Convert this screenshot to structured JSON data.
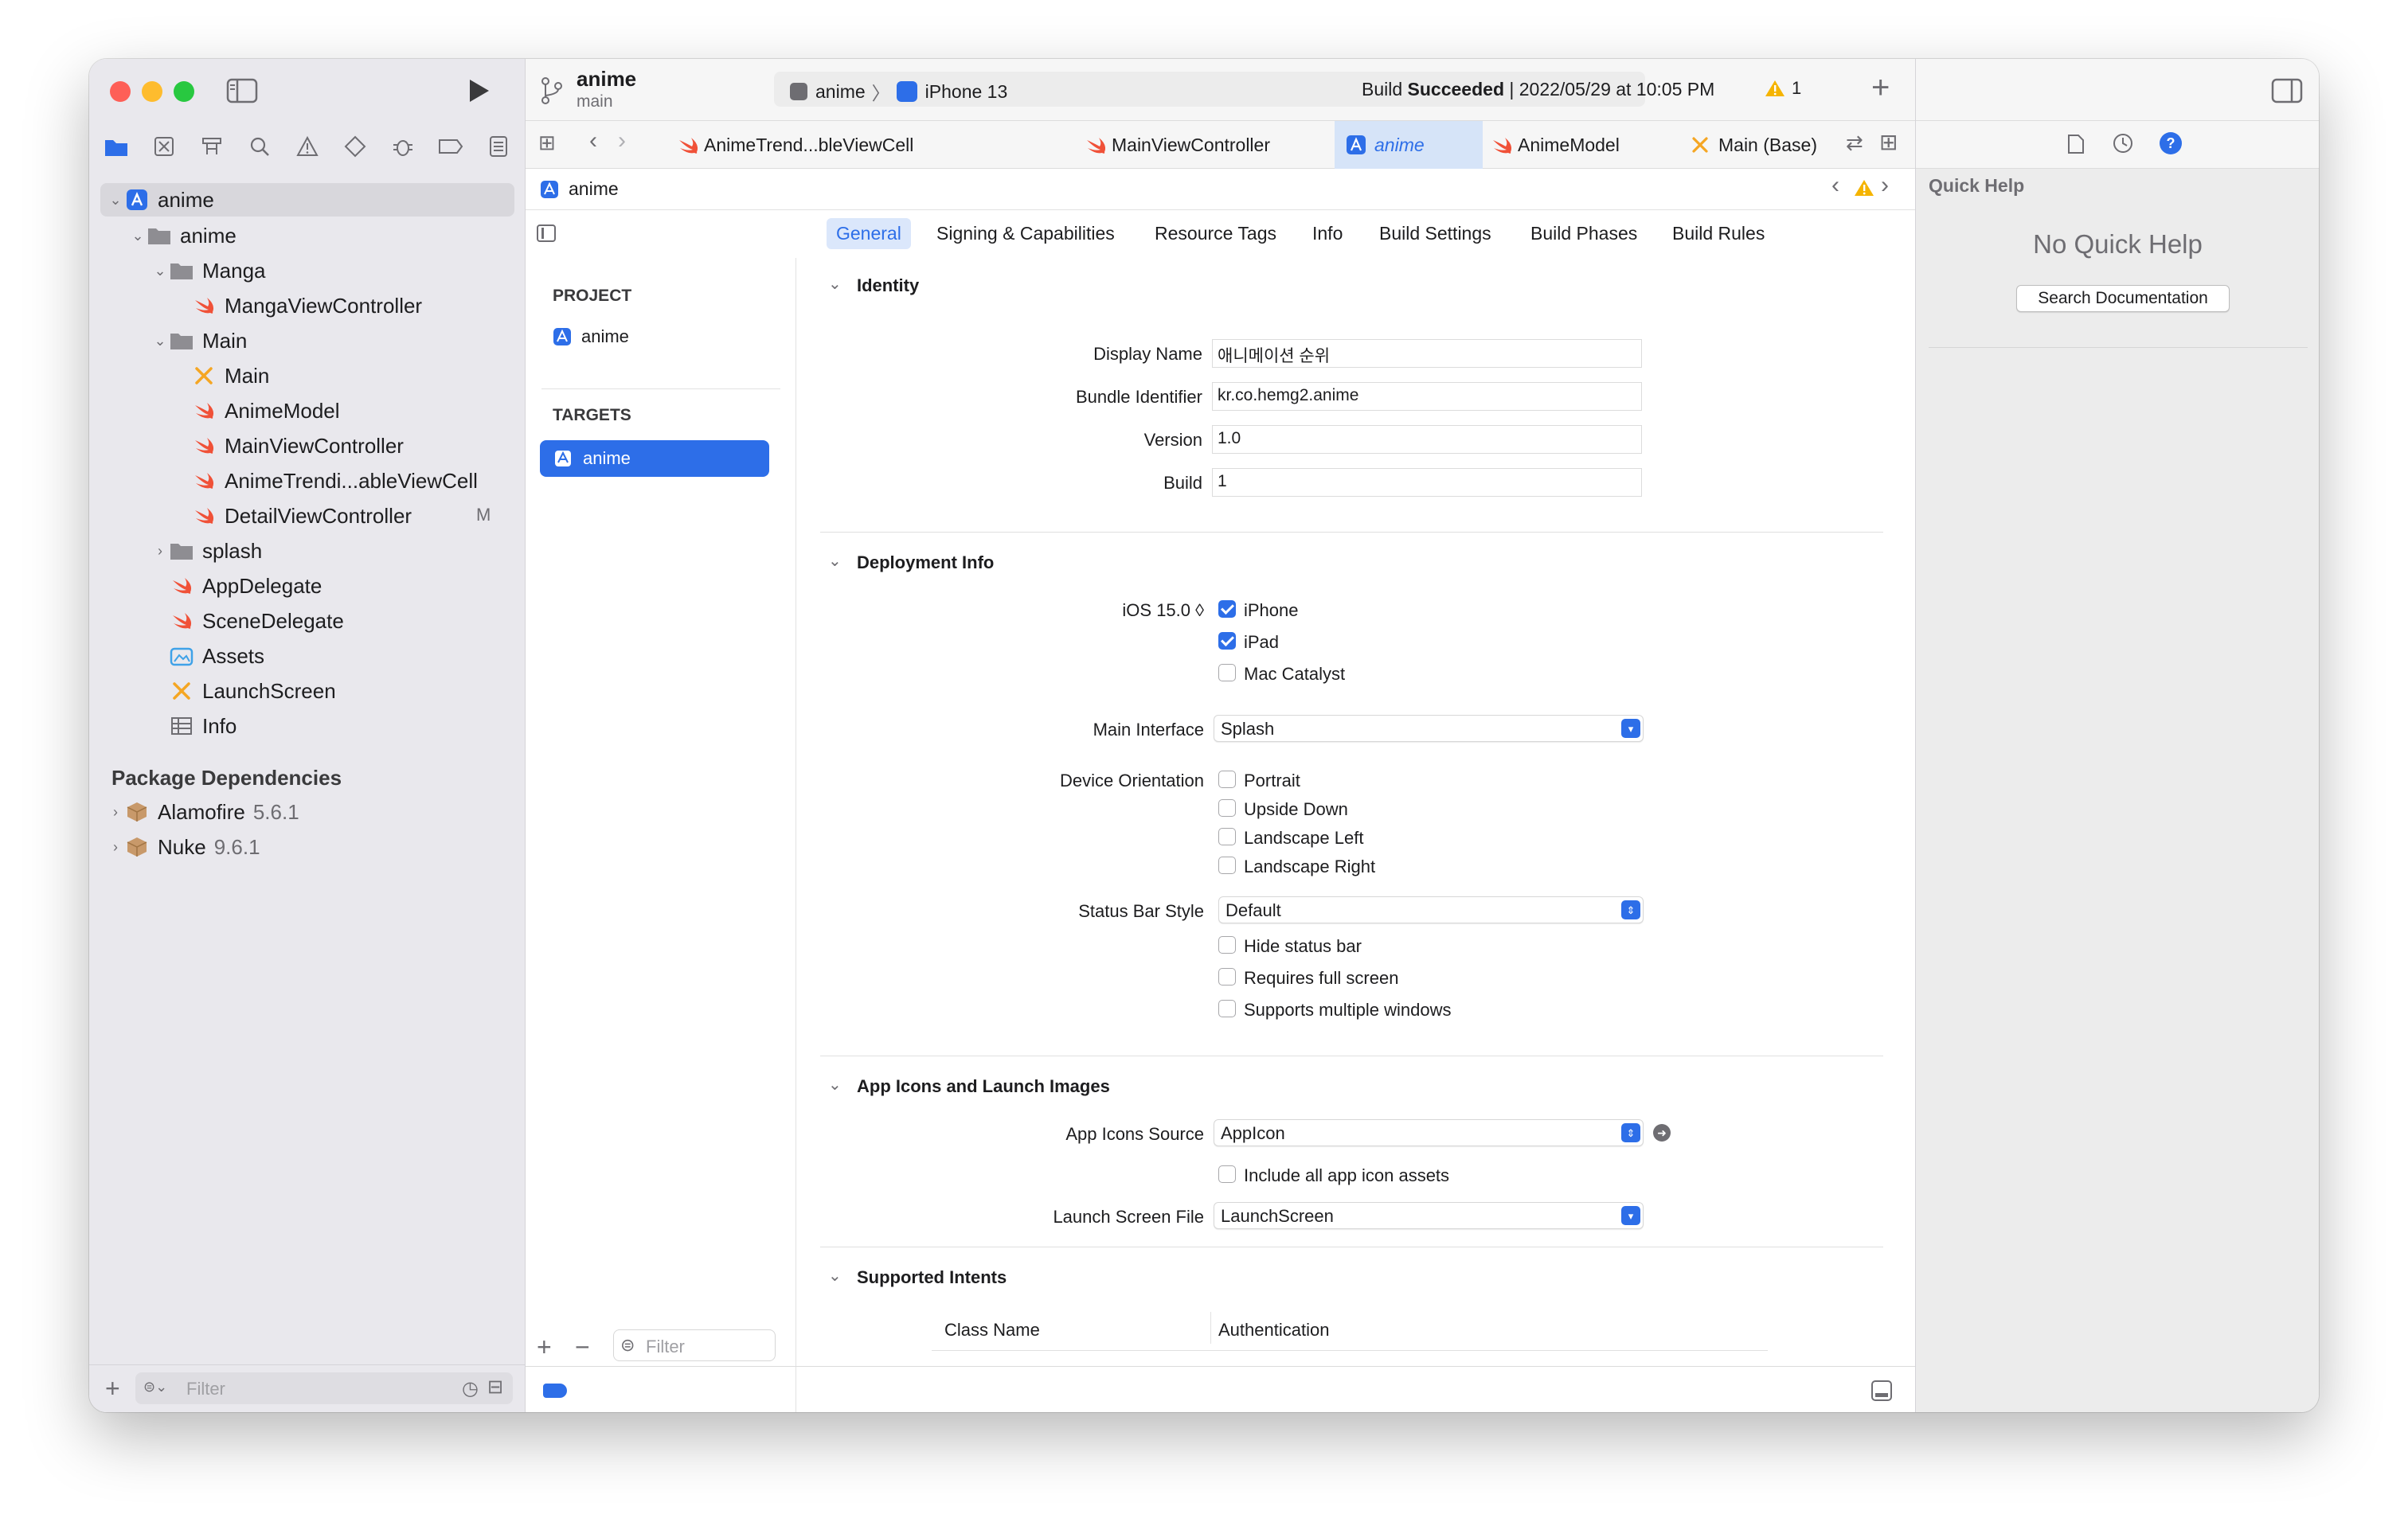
{
  "project": {
    "name": "anime",
    "branch": "main"
  },
  "toolbar": {
    "scheme": "anime",
    "device": "iPhone 13",
    "status_prefix": "Build ",
    "status_bold": "Succeeded",
    "status_suffix": " | 2022/05/29 at 10:05 PM",
    "warning_count": "1"
  },
  "navigator": {
    "root": "anime",
    "items": [
      {
        "label": "anime"
      },
      {
        "label": "Manga"
      },
      {
        "label": "MangaViewController"
      },
      {
        "label": "Main"
      },
      {
        "label": "Main"
      },
      {
        "label": "AnimeModel"
      },
      {
        "label": "MainViewController"
      },
      {
        "label": "AnimeTrendi...ableViewCell"
      },
      {
        "label": "DetailViewController",
        "badge": "M"
      },
      {
        "label": "splash"
      },
      {
        "label": "AppDelegate"
      },
      {
        "label": "SceneDelegate"
      },
      {
        "label": "Assets"
      },
      {
        "label": "LaunchScreen"
      },
      {
        "label": "Info"
      }
    ],
    "packages_title": "Package Dependencies",
    "packages": [
      {
        "name": "Alamofire",
        "version": "5.6.1"
      },
      {
        "name": "Nuke",
        "version": "9.6.1"
      }
    ],
    "filter_placeholder": "Filter"
  },
  "tabs": [
    {
      "label": "AnimeTrend...bleViewCell"
    },
    {
      "label": "MainViewController"
    },
    {
      "label": "anime"
    },
    {
      "label": "AnimeModel"
    },
    {
      "label": "Main (Base)"
    }
  ],
  "jumpbar": {
    "label": "anime"
  },
  "segments": [
    "General",
    "Signing & Capabilities",
    "Resource Tags",
    "Info",
    "Build Settings",
    "Build Phases",
    "Build Rules"
  ],
  "targets_pane": {
    "project_header": "PROJECT",
    "project_item": "anime",
    "targets_header": "TARGETS",
    "target_item": "anime",
    "filter_placeholder": "Filter"
  },
  "identity": {
    "title": "Identity",
    "display_name_label": "Display Name",
    "display_name": "애니메이션 순위",
    "bundle_label": "Bundle Identifier",
    "bundle": "kr.co.hemg2.anime",
    "version_label": "Version",
    "version": "1.0",
    "build_label": "Build",
    "build": "1"
  },
  "deployment": {
    "title": "Deployment Info",
    "ios": "iOS 15.0 ◊",
    "iphone": "iPhone",
    "ipad": "iPad",
    "mac": "Mac Catalyst",
    "main_interface_label": "Main Interface",
    "main_interface": "Splash",
    "orientation_label": "Device Orientation",
    "portrait": "Portrait",
    "upside": "Upside Down",
    "landscape_left": "Landscape Left",
    "landscape_right": "Landscape Right",
    "status_style_label": "Status Bar Style",
    "status_style": "Default",
    "hide_status": "Hide status bar",
    "full_screen": "Requires full screen",
    "multi_windows": "Supports multiple windows"
  },
  "app_icons": {
    "title": "App Icons and Launch Images",
    "source_label": "App Icons Source",
    "source": "AppIcon",
    "include_all": "Include all app icon assets",
    "launch_label": "Launch Screen File",
    "launch": "LaunchScreen"
  },
  "intents": {
    "title": "Supported Intents",
    "col_class": "Class Name",
    "col_auth": "Authentication"
  },
  "quick_help": {
    "title": "Quick Help",
    "empty": "No Quick Help",
    "search_button": "Search Documentation"
  },
  "colors": {
    "accent": "#2d6ee8",
    "swift": "#f05138",
    "warning": "#f5b400"
  }
}
